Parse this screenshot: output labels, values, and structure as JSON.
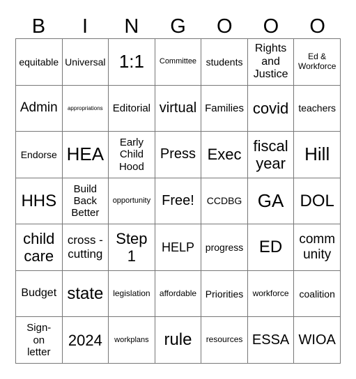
{
  "header": [
    "B",
    "I",
    "N",
    "G",
    "O",
    "O",
    "O"
  ],
  "cells": [
    [
      "equitable",
      "Universal",
      "1:1",
      "Committee",
      "students",
      "Rights\nand\nJustice",
      "Ed &\nWorkforce"
    ],
    [
      "Admin",
      "appropriations",
      "Editorial",
      "virtual",
      "Families",
      "covid",
      "teachers"
    ],
    [
      "Endorse",
      "HEA",
      "Early\nChild\nHood",
      "Press",
      "Exec",
      "fiscal\nyear",
      "Hill"
    ],
    [
      "HHS",
      "Build\nBack\nBetter",
      "opportunity",
      "Free!",
      "CCDBG",
      "GA",
      "DOL"
    ],
    [
      "child\ncare",
      "cross -\ncutting",
      "Step\n1",
      "HELP",
      "progress",
      "ED",
      "comm\nunity"
    ],
    [
      "Budget",
      "state",
      "legislation",
      "affordable",
      "Priorities",
      "workforce",
      "coalition"
    ],
    [
      "Sign-\non\nletter",
      "2024",
      "workplans",
      "rule",
      "resources",
      "ESSA",
      "WIOA"
    ]
  ]
}
